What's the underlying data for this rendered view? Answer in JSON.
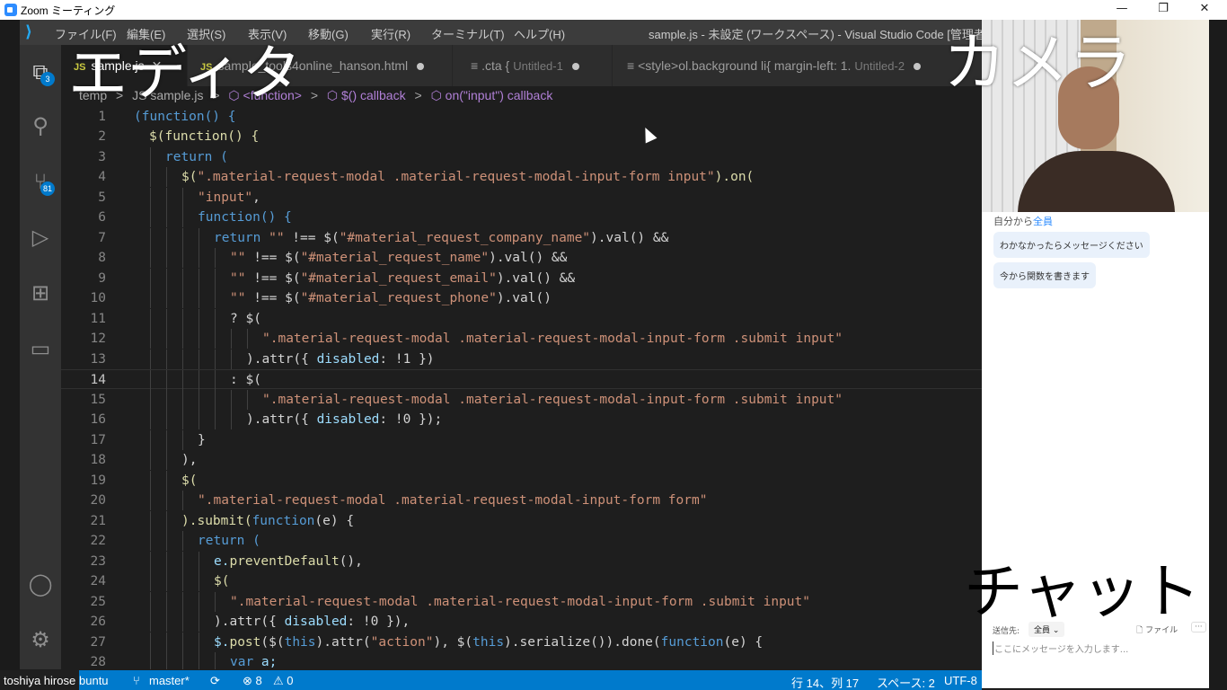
{
  "zoom_window": {
    "title": "Zoom ミーティング",
    "minimize": "—",
    "restore": "❐",
    "close": "✕"
  },
  "vscode": {
    "logo": "⟩",
    "menu": [
      "ファイル(F)",
      "編集(E)",
      "選択(S)",
      "表示(V)",
      "移動(G)",
      "実行(R)",
      "ターミナル(T)",
      "ヘルプ(H)"
    ],
    "window_title": "sample.js - 未設定 (ワークスペース) - Visual Studio Code [管理者]",
    "activity_badges": {
      "explorer": "3",
      "source_control": "81"
    },
    "tabs": [
      {
        "icon": "JS",
        "label": "sample.js",
        "close": "✕"
      },
      {
        "icon": "JS",
        "label": "sample_tools4online_hanson.html"
      },
      {
        "icon": "≡",
        "label": ".cta {",
        "desc": "Untitled-1"
      },
      {
        "icon": "≡",
        "label": "<style>ol.background li{ margin-left: 1.",
        "desc": "Untitled-2"
      }
    ],
    "breadcrumb": [
      "temp",
      ">",
      "JS sample.js",
      ">",
      "⬡ <function>",
      ">",
      "⬡ $() callback",
      ">",
      "⬡ on(\"input\") callback"
    ],
    "status": {
      "branch_prefix": "buntu",
      "branch": "master*",
      "sync": "⟳",
      "errors": "⊗ 8",
      "warnings": "⚠ 0",
      "position": "行 14、列 17",
      "spaces": "スペース: 2",
      "encoding": "UTF-8"
    }
  },
  "participant_name": "toshiya hirose",
  "code_lines": [
    {
      "n": "1"
    },
    {
      "n": "2"
    },
    {
      "n": "3"
    },
    {
      "n": "4"
    },
    {
      "n": "5"
    },
    {
      "n": "6"
    },
    {
      "n": "7"
    },
    {
      "n": "8"
    },
    {
      "n": "9"
    },
    {
      "n": "10"
    },
    {
      "n": "11"
    },
    {
      "n": "12"
    },
    {
      "n": "13"
    },
    {
      "n": "14"
    },
    {
      "n": "15"
    },
    {
      "n": "16"
    },
    {
      "n": "17"
    },
    {
      "n": "18"
    },
    {
      "n": "19"
    },
    {
      "n": "20"
    },
    {
      "n": "21"
    },
    {
      "n": "22"
    },
    {
      "n": "23"
    },
    {
      "n": "24"
    },
    {
      "n": "25"
    },
    {
      "n": "26"
    },
    {
      "n": "27"
    },
    {
      "n": "28"
    }
  ],
  "code": {
    "l1": "(function() {",
    "l2": "$(function() {",
    "l3": "return (",
    "l4a": "$(",
    "l4s": "\".material-request-modal .material-request-modal-input-form input\"",
    "l4b": ").on(",
    "l5": "\"input\"",
    "l6": "function() {",
    "l7a": "return ",
    "l7s1": "\"\"",
    "l7b": " !== $(",
    "l7s2": "\"#material_request_company_name\"",
    "l7c": ").val() &&",
    "l8s1": "\"\"",
    "l8b": " !== $(",
    "l8s2": "\"#material_request_name\"",
    "l8c": ").val() &&",
    "l9s2": "\"#material_request_email\"",
    "l10s2": "\"#material_request_phone\"",
    "l10c": ").val()",
    "l11": "? $(",
    "l12": "\".material-request-modal .material-request-modal-input-form .submit input\"",
    "l13a": ").attr({ ",
    "l13v": "disabled",
    "l13b": ": !1 })",
    "l14": ": $(",
    "l16b": ": !0 });",
    "l17": "}",
    "l18": "),",
    "l19": "$(",
    "l20": "\".material-request-modal .material-request-modal-input-form form\"",
    "l21a": ").submit(",
    "l21b": "function",
    "l21c": "(e) {",
    "l22": "return (",
    "l23a": "e.",
    "l23b": "preventDefault",
    "l23c": "(),",
    "l24": "$(",
    "l26b": ": !0 }),",
    "l27a": "$.",
    "l27b": "post",
    "l27c": "($(",
    "l27d": "this",
    "l27e": ").attr(",
    "l27f": "\"action\"",
    "l27g": "), $(",
    "l27h": ").serialize()).done(",
    "l27i": "(e) {",
    "l28a": "var ",
    "l28b": "a;"
  },
  "chat": {
    "to_prefix": "自分から",
    "to_target": "全員",
    "messages": [
      "わかなかったらメッセージください",
      "今から関数を書きます"
    ],
    "send_to_label": "送信先:",
    "send_to_value": "全員 ⌄",
    "file_button": "🗋 ファイル",
    "more": "···",
    "input_placeholder": "ここにメッセージを入力します..."
  },
  "overlays": {
    "editor": "エディタ",
    "camera": "カメラ",
    "chat": "チャット"
  },
  "colors": {
    "vscode_accent": "#007acc",
    "zoom_blue": "#2d8cff",
    "editor_bg": "#1e1e1e"
  }
}
